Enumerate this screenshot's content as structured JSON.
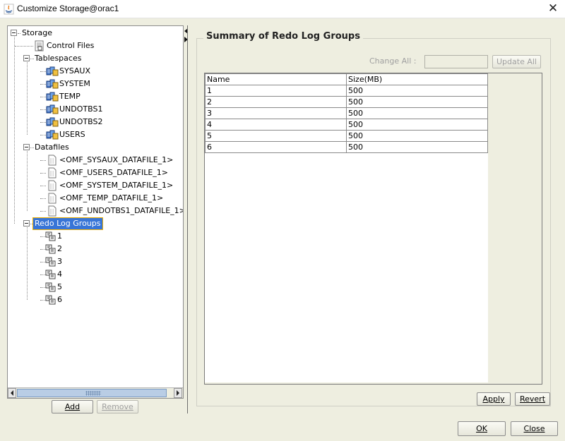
{
  "window": {
    "title": "Customize Storage@orac1"
  },
  "tree": {
    "root": "Storage",
    "control_files": "Control Files",
    "tablespaces": {
      "label": "Tablespaces",
      "items": [
        "SYSAUX",
        "SYSTEM",
        "TEMP",
        "UNDOTBS1",
        "UNDOTBS2",
        "USERS"
      ]
    },
    "datafiles": {
      "label": "Datafiles",
      "items": [
        "<OMF_SYSAUX_DATAFILE_1>",
        "<OMF_USERS_DATAFILE_1>",
        "<OMF_SYSTEM_DATAFILE_1>",
        "<OMF_TEMP_DATAFILE_1>",
        "<OMF_UNDOTBS1_DATAFILE_1>"
      ]
    },
    "redo": {
      "label": "Redo Log Groups",
      "items": [
        "1",
        "2",
        "3",
        "4",
        "5",
        "6"
      ]
    }
  },
  "tree_buttons": {
    "add": "Add",
    "remove": "Remove"
  },
  "summary": {
    "title": "Summary of Redo Log Groups",
    "change_all_label": "Change All :",
    "change_all_value": "",
    "update_all": "Update All",
    "columns": [
      "Name",
      "Size(MB)"
    ],
    "rows": [
      [
        "1",
        "500"
      ],
      [
        "2",
        "500"
      ],
      [
        "3",
        "500"
      ],
      [
        "4",
        "500"
      ],
      [
        "5",
        "500"
      ],
      [
        "6",
        "500"
      ]
    ],
    "apply": "Apply",
    "revert": "Revert"
  },
  "footer": {
    "ok": "OK",
    "close": "Close"
  },
  "colors": {
    "selection": "#3875d7",
    "focus": "#f0b000",
    "background": "#eeeee0"
  }
}
